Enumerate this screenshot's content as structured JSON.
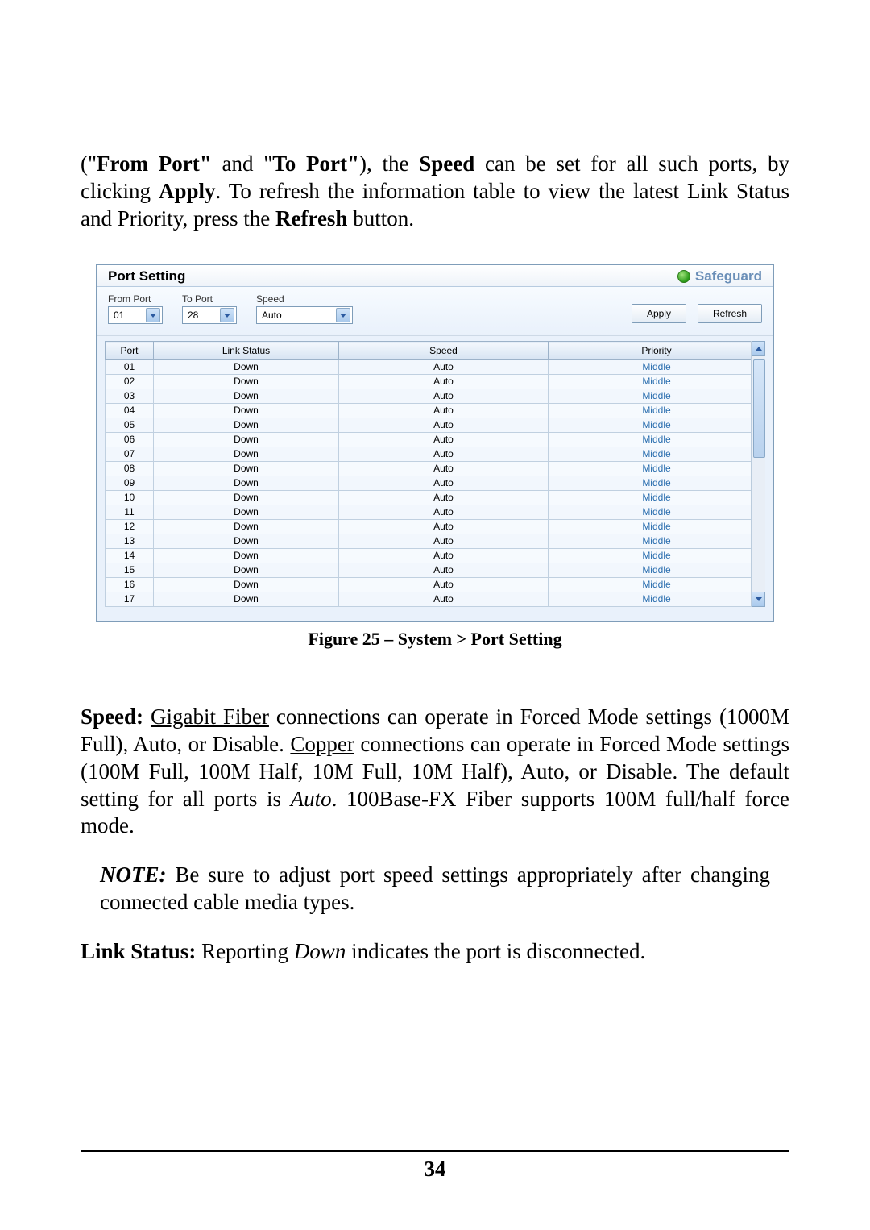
{
  "intro": {
    "seg1": "(\"",
    "from_port_bold": "From Port\"",
    "seg2": " and \"",
    "to_port_bold": "To Port\"",
    "seg3": "), the ",
    "speed_bold": "Speed",
    "seg4": " can be set for all such ports, by clicking ",
    "apply_bold": "Apply",
    "seg5": ". To refresh the information table to view the latest Link Status and Priority, press the ",
    "refresh_bold": "Refresh",
    "seg6": " button."
  },
  "panel": {
    "title": "Port Setting",
    "safeguard": "Safeguard",
    "labels": {
      "from_port": "From Port",
      "to_port": "To Port",
      "speed": "Speed"
    },
    "selects": {
      "from_port": "01",
      "to_port": "28",
      "speed": "Auto"
    },
    "buttons": {
      "apply": "Apply",
      "refresh": "Refresh"
    },
    "columns": {
      "port": "Port",
      "link_status": "Link Status",
      "speed": "Speed",
      "priority": "Priority"
    },
    "rows": [
      {
        "port": "01",
        "link_status": "Down",
        "speed": "Auto",
        "priority": "Middle"
      },
      {
        "port": "02",
        "link_status": "Down",
        "speed": "Auto",
        "priority": "Middle"
      },
      {
        "port": "03",
        "link_status": "Down",
        "speed": "Auto",
        "priority": "Middle"
      },
      {
        "port": "04",
        "link_status": "Down",
        "speed": "Auto",
        "priority": "Middle"
      },
      {
        "port": "05",
        "link_status": "Down",
        "speed": "Auto",
        "priority": "Middle"
      },
      {
        "port": "06",
        "link_status": "Down",
        "speed": "Auto",
        "priority": "Middle"
      },
      {
        "port": "07",
        "link_status": "Down",
        "speed": "Auto",
        "priority": "Middle"
      },
      {
        "port": "08",
        "link_status": "Down",
        "speed": "Auto",
        "priority": "Middle"
      },
      {
        "port": "09",
        "link_status": "Down",
        "speed": "Auto",
        "priority": "Middle"
      },
      {
        "port": "10",
        "link_status": "Down",
        "speed": "Auto",
        "priority": "Middle"
      },
      {
        "port": "11",
        "link_status": "Down",
        "speed": "Auto",
        "priority": "Middle"
      },
      {
        "port": "12",
        "link_status": "Down",
        "speed": "Auto",
        "priority": "Middle"
      },
      {
        "port": "13",
        "link_status": "Down",
        "speed": "Auto",
        "priority": "Middle"
      },
      {
        "port": "14",
        "link_status": "Down",
        "speed": "Auto",
        "priority": "Middle"
      },
      {
        "port": "15",
        "link_status": "Down",
        "speed": "Auto",
        "priority": "Middle"
      },
      {
        "port": "16",
        "link_status": "Down",
        "speed": "Auto",
        "priority": "Middle"
      },
      {
        "port": "17",
        "link_status": "Down",
        "speed": "Auto",
        "priority": "Middle"
      }
    ]
  },
  "figure_caption": "Figure 25 – System > Port Setting",
  "speed_para": {
    "label": "Speed:",
    "u1": "Gigabit Fiber",
    "t1": " connections can operate in Forced Mode settings (1000M Full), Auto, or Disable. ",
    "u2": "Copper",
    "t2": " connections can operate in Forced Mode settings (100M Full, 100M Half, 10M Full, 10M Half), Auto, or Disable. The default setting for all ports is ",
    "i1": "Auto",
    "t3": ". 100Base-FX Fiber supports 100M full/half force mode."
  },
  "note": {
    "label": "NOTE:",
    "text": " Be sure to adjust port speed settings appropriately after changing connected cable media types."
  },
  "link_status_para": {
    "label": "Link Status:",
    "t1": " Reporting ",
    "i1": "Down",
    "t2": " indicates the port is disconnected."
  },
  "page_number": "34"
}
